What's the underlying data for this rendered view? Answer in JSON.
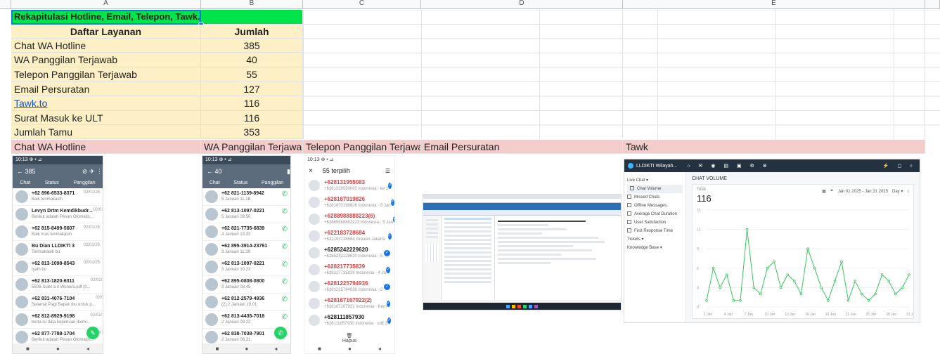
{
  "columns": [
    "A",
    "B",
    "C",
    "D",
    "E"
  ],
  "title": "Rekapitulasi Hotline, Email, Telepon, Tawk.to",
  "table": {
    "header": {
      "service": "Daftar Layanan",
      "count": "Jumlah"
    },
    "rows": [
      {
        "service": "Chat WA Hotline",
        "count": "385"
      },
      {
        "service": "WA Panggilan Terjawab",
        "count": "40"
      },
      {
        "service": "Telepon Panggilan Terjawab",
        "count": "55"
      },
      {
        "service": "Email Persuratan",
        "count": "127"
      },
      {
        "service": "Tawk.to",
        "count": "116"
      },
      {
        "service": "Surat Masuk ke ULT",
        "count": "116"
      },
      {
        "service": "Jumlah Tamu",
        "count": "353"
      }
    ]
  },
  "screenshot_headers": [
    "Chat WA Hotline",
    "WA Panggilan Terjawab",
    "Telepon Panggilan Terjawab",
    "Email Persuratan",
    "Tawk"
  ],
  "wa_chat": {
    "status_bar": "10:13 ⊕ • ⊿",
    "title": "385",
    "tabs": [
      "Chat",
      "Status",
      "Panggilan"
    ],
    "items": [
      {
        "name": "+62 896-6533-8371",
        "msg": "Baik terimakasih",
        "date": "02/01/25"
      },
      {
        "name": "Levyn Drtm Kemdikbudr...",
        "msg": "Berikut adalah Pesan Otomatis...",
        "date": "02/01/25"
      },
      {
        "name": "+62 815-8499-5607",
        "msg": "Baik mas terimakasih",
        "date": "02/01/25"
      },
      {
        "name": "Bu Dian LLDIKTI 3",
        "msg": "Terimakasih bu",
        "date": "02/01/25"
      },
      {
        "name": "+62 813-1098-8543",
        "msg": "Iyaih bu",
        "date": "02/01/25"
      },
      {
        "name": "+62 813-1820-6311",
        "msg": "5506-Sulet a.n Wunara.pdf (0...",
        "date": "02/01/25"
      },
      {
        "name": "+62 831-4076-7104",
        "msg": "Selamat Pagi Bapak Ibu untuk p...",
        "date": "02/01/25"
      },
      {
        "name": "+62 812-8929-9198",
        "msg": "berta isi data keperluan diomi...",
        "date": "02/01/25"
      },
      {
        "name": "+62 877-7788-1704",
        "msg": "Berikut adalah Pesan Otomatis...",
        "date": "02/01/25"
      }
    ]
  },
  "wa_calls": {
    "status_bar": "10:13 ⊕ • ⊿",
    "title": "40",
    "tabs": [
      "Chat",
      "Status",
      "Panggilan"
    ],
    "items": [
      {
        "name": "+62 821-1139-8942",
        "sub": "5 Januari 11.18"
      },
      {
        "name": "+62 813-1097-0221",
        "sub": "5 Januari 09.50"
      },
      {
        "name": "+62 821-7735-6839",
        "sub": "4 Januari 13.32"
      },
      {
        "name": "+62 895-3914-23761",
        "sub": "3 Januari 11.39"
      },
      {
        "name": "+62 813-1097-0221",
        "sub": "3 Januari 10.23"
      },
      {
        "name": "+62 895-0808-0800",
        "sub": "3 Januari 08.45"
      },
      {
        "name": "+62 812-2579-4936",
        "sub": "(2) 2 Januari 19.01"
      },
      {
        "name": "+62 813-4435-7018",
        "sub": "2 Januari 09.22"
      },
      {
        "name": "+62 838-7038-7901",
        "sub": "2 Januari 08.31"
      }
    ]
  },
  "phone_log": {
    "status_bar": "10:13 ⊕ • ⊿",
    "close": "×",
    "title": "55 terpilih",
    "items": [
      {
        "num": "+628131955083",
        "sub": "+6281319550083 Indonesia · ke 1",
        "color": "#e04040"
      },
      {
        "num": "+628167019826",
        "sub": "+6281670198826 Indonesia · 5 Jan",
        "color": "#e04040"
      },
      {
        "num": "+6288988888223(6)",
        "sub": "+62889888882223 Indonesia · 5 Jan",
        "color": "#e04040"
      },
      {
        "num": "+622183728684",
        "sub": "+622183728684 Greater Jakarta ·",
        "color": "#e04040"
      },
      {
        "num": "+6285242229620",
        "sub": "+6285242229620 Indonesia · 5",
        "color": "#222222"
      },
      {
        "num": "+628217735839",
        "sub": "+628217735839 Indonesia · 4 Ja",
        "color": "#e04040"
      },
      {
        "num": "+6281225794936",
        "sub": "+6281225794936 Indonesia · 2",
        "color": "#e04040"
      },
      {
        "num": "+628167167922(2)",
        "sub": "+628167167922 Indonesia · Kem",
        "color": "#e04040"
      },
      {
        "num": "+628111857930",
        "sub": "+628111857930 Indonesia · sdk 3",
        "color": "#222222"
      }
    ],
    "delete_label": "Hapus"
  },
  "tawk": {
    "brand": "LLDIKTI Wilayah...",
    "nav_title": "Live Chat",
    "side_items": [
      "Chat Volume",
      "Missed Chats",
      "Offline Messages",
      "Average Chat Duration",
      "User Satisfaction",
      "First Response Time"
    ],
    "side_groups": [
      "Tickets",
      "Knowledge Base"
    ],
    "chart_title": "CHAT VOLUME",
    "total_label": "Total",
    "total_value": "116",
    "date_range": "Jan 01 2025 - Jan 31 2025",
    "period": "Day"
  },
  "chart_data": {
    "type": "line",
    "title": "CHAT VOLUME",
    "ylim": [
      0,
      15
    ],
    "y_ticks": [
      "0",
      "3",
      "6",
      "9",
      "12",
      "15"
    ],
    "x_tick_labels": [
      "1 Jan",
      "4 Jan",
      "7 Jan",
      "10 Jan",
      "13 Jan",
      "16 Jan",
      "19 Jan",
      "22 Jan",
      "25 Jan",
      "28 Jan",
      "31 Jan"
    ],
    "series": [
      {
        "values": [
          1,
          6,
          3,
          5,
          1,
          1,
          12,
          3,
          2,
          6,
          7,
          3,
          5,
          4,
          2,
          9,
          6,
          3,
          1,
          4,
          7,
          1,
          4,
          2,
          1,
          2,
          5,
          4,
          2,
          3,
          5
        ],
        "color": "#35c759"
      }
    ]
  }
}
